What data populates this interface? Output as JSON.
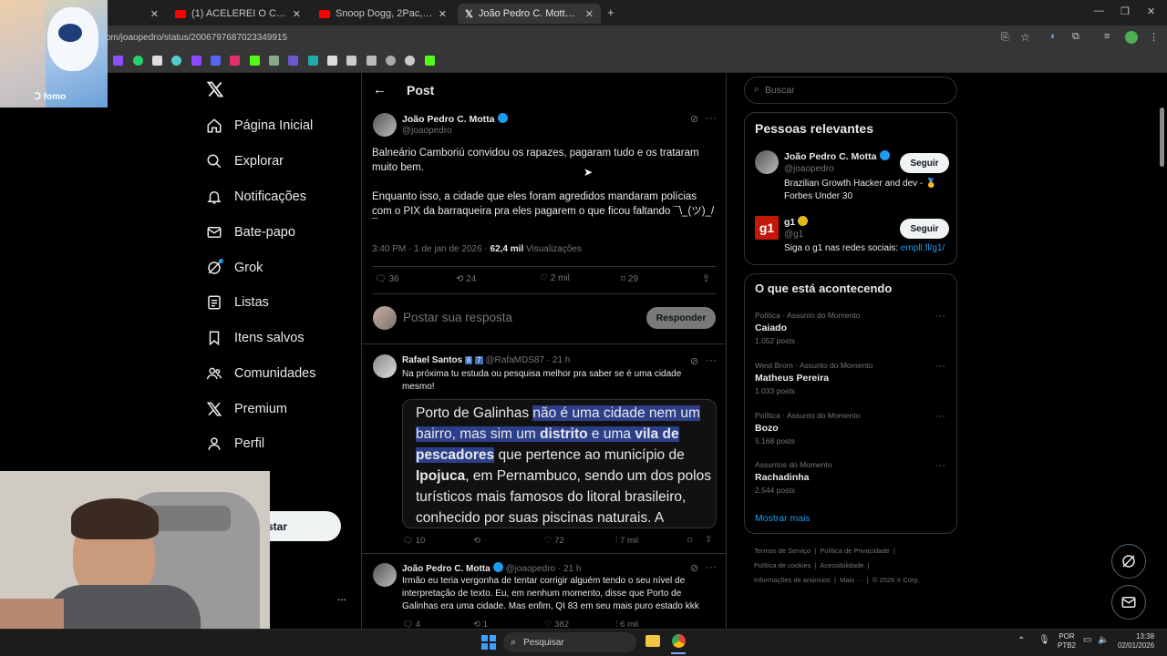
{
  "browser": {
    "tabs": [
      {
        "title": "",
        "favicon_color": "#ffffff"
      },
      {
        "title": "(1) ACELEREI O CARRO MAIS I...",
        "favicon_color": "#ff0000"
      },
      {
        "title": "Snoop Dogg, 2Pac, Wiz Khalifa",
        "favicon_color": "#ff0000"
      },
      {
        "title": "João Pedro C. Motta no X: \"@j...",
        "favicon_color": "#ffffff"
      }
    ],
    "url": "om/joaopedro/status/2006797687023349915"
  },
  "webcam": {
    "overlay_text": "fomo"
  },
  "sidebar": {
    "items": [
      {
        "label": "Página Inicial",
        "icon": "home-icon"
      },
      {
        "label": "Explorar",
        "icon": "search-icon"
      },
      {
        "label": "Notificações",
        "icon": "bell-icon"
      },
      {
        "label": "Bate-papo",
        "icon": "mail-icon"
      },
      {
        "label": "Grok",
        "icon": "grok-icon"
      },
      {
        "label": "Listas",
        "icon": "list-icon"
      },
      {
        "label": "Itens salvos",
        "icon": "bookmark-icon"
      },
      {
        "label": "Comunidades",
        "icon": "people-icon"
      },
      {
        "label": "Premium",
        "icon": "x-icon"
      },
      {
        "label": "Perfil",
        "icon": "person-icon"
      }
    ],
    "post_button": "star",
    "account_more": "..."
  },
  "post": {
    "header": "Post",
    "author_name": "João Pedro C. Motta",
    "author_handle": "@joaopedro",
    "text_p1_l1": "Balneário Camboriú convidou os rapazes, pagaram tudo e os trataram",
    "text_p1_l2": "muito bem.",
    "text_p2_l1": "Enquanto isso, a cidade que eles foram agredidos mandaram polícias",
    "text_p2_l2": "com o PIX da barraqueira pra eles pagarem o que ficou faltando ¯\\_(ツ)_/",
    "text_p2_l3": "¯",
    "time": "3:40 PM · 1 de jan de 2026 ·",
    "views_count": "62,4 mil",
    "views_label": "Visualizações",
    "replies": "36",
    "reposts": "24",
    "likes": "2 mil",
    "bookmarks": "29"
  },
  "reply_box": {
    "placeholder": "Postar sua resposta",
    "button": "Responder"
  },
  "reply1": {
    "name": "Rafael Santos",
    "badge1": "8",
    "badge2": "7",
    "handle": "@RafaMDS87 · 21 h",
    "text_l1": "Na próxima tu estuda ou pesquisa melhor pra saber se é uma cidade",
    "text_l2": "mesmo!",
    "quote_l1_a": "Porto de Galinhas ",
    "quote_l1_b": "não é uma cidade nem um",
    "quote_l2_a": "bairro, mas sim um ",
    "quote_l2_b": "distrito",
    "quote_l2_c": " e uma ",
    "quote_l2_d": "vila de",
    "quote_l3_a": "pescadores",
    "quote_l3_b": " que pertence ao município de",
    "quote_l4_a": "Ipojuca",
    "quote_l4_b": ", em Pernambuco, sendo um dos polos",
    "quote_l5": "turísticos mais famosos do litoral brasileiro,",
    "quote_l6": "conhecido por suas piscinas naturais. A",
    "replies": "10",
    "likes": "72",
    "views": "7 mil"
  },
  "reply2": {
    "name": "João Pedro C. Motta",
    "handle": "@joaopedro · 21 h",
    "text_l1": "Irmão eu teria vergonha de tentar corrigir alguém tendo o seu nível de",
    "text_l2": "interpretação de texto. Eu, em nenhum momento, disse que Porto de",
    "text_l3": "Galinhas era uma cidade. Mas enfim, QI 83 em seu mais puro estado kkk",
    "replies": "4",
    "reposts": "1",
    "likes": "382",
    "views": "6 mil"
  },
  "search": {
    "placeholder": "Buscar"
  },
  "relevant": {
    "title": "Pessoas relevantes",
    "p1_name": "João Pedro C. Motta",
    "p1_handle": "@joaopedro",
    "p1_bio_l1": "Brazilian Growth Hacker and dev - 🥇",
    "p1_bio_l2": "Forbes Under 30",
    "p2_name": "g1",
    "p2_handle": "@g1",
    "p2_bio": "Siga o g1 nas redes sociais: ",
    "p2_link": "empll.fl/g1/",
    "follow": "Seguir",
    "g1_logo": "g1"
  },
  "trends": {
    "title": "O que está acontecendo",
    "items": [
      {
        "context": "Política · Assunto do Momento",
        "name": "Caiado",
        "count": "1.052 posts"
      },
      {
        "context": "West Brom · Assunto do Momento",
        "name": "Matheus Pereira",
        "count": "1.033 posts"
      },
      {
        "context": "Política · Assunto do Momento",
        "name": "Bozo",
        "count": "5.168 posts"
      },
      {
        "context": "Assuntos do Momento",
        "name": "Rachadinha",
        "count": "2.544 posts"
      }
    ],
    "more": "Mostrar mais"
  },
  "footer": {
    "l1_a": "Termos de Serviço",
    "l1_b": "Política de Privacidade",
    "l2_a": "Política de cookies",
    "l2_b": "Acessibilidade",
    "l3_a": "Informações de anúncios",
    "l3_b": "Mais ···",
    "l3_c": "© 2026 X Corp."
  },
  "taskbar": {
    "search": "Pesquisar",
    "lang_top": "POR",
    "lang_bottom": "PTB2",
    "time": "13:38",
    "date": "02/01/2026"
  },
  "colors": {
    "accent": "#1d9bf0",
    "background": "#000000",
    "border": "#2f3336",
    "muted": "#71767b"
  }
}
